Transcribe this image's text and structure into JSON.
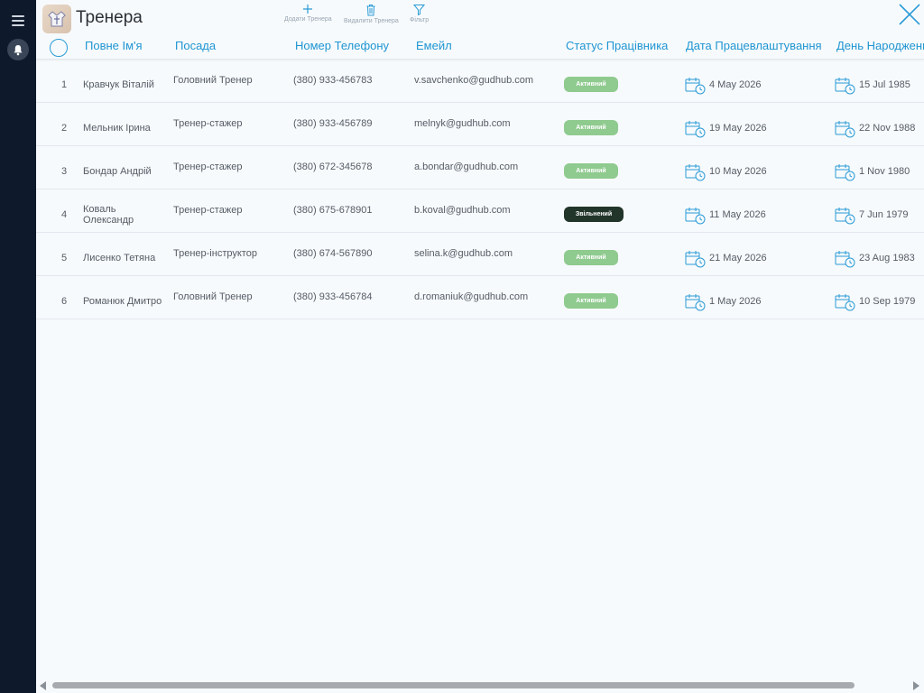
{
  "page": {
    "title": "Тренера"
  },
  "toolbar": {
    "add_label": "Додати Тренера",
    "delete_label": "Видалити Тренера",
    "filter_label": "Фільтр"
  },
  "columns": {
    "name": "Повне Ім'я",
    "position": "Посада",
    "phone": "Номер Телефону",
    "email": "Емейл",
    "status": "Статус Працівника",
    "hire_date": "Дата Працевлаштування",
    "birthday": "День Народження"
  },
  "rows": [
    {
      "num": "1",
      "name": "Кравчук Віталій",
      "position": "Головний Тренер",
      "phone": "(380) 933-456783",
      "email": "v.savchenko@gudhub.com",
      "status": "Активний",
      "hire_date": "4 May 2026",
      "birthday": "15 Jul 1985"
    },
    {
      "num": "2",
      "name": "Мельник Ірина",
      "position": "Тренер-стажер",
      "phone": "(380) 933-456789",
      "email": "melnyk@gudhub.com",
      "status": "Активний",
      "hire_date": "19 May 2026",
      "birthday": "22 Nov 1988"
    },
    {
      "num": "3",
      "name": "Бондар Андрій",
      "position": "Тренер-стажер",
      "phone": "(380) 672-345678",
      "email": "a.bondar@gudhub.com",
      "status": "Активний",
      "hire_date": "10 May 2026",
      "birthday": "1 Nov 1980"
    },
    {
      "num": "4",
      "name": "Коваль Олександр",
      "position": "Тренер-стажер",
      "phone": "(380) 675-678901",
      "email": "b.koval@gudhub.com",
      "status": "Звільнений",
      "hire_date": "11 May 2026",
      "birthday": "7 Jun 1979"
    },
    {
      "num": "5",
      "name": "Лисенко Тетяна",
      "position": "Тренер-інструктор",
      "phone": "(380) 674-567890",
      "email": "selina.k@gudhub.com",
      "status": "Активний",
      "hire_date": "21 May 2026",
      "birthday": "23 Aug 1983"
    },
    {
      "num": "6",
      "name": "Романюк Дмитро",
      "position": "Головний Тренер",
      "phone": "(380) 933-456784",
      "email": "d.romaniuk@gudhub.com",
      "status": "Активний",
      "hire_date": "1 May 2026",
      "birthday": "10 Sep 1979"
    }
  ],
  "colors": {
    "sidebar": "#0e1a2b",
    "accent": "#1f95d2",
    "status_active": "#8fca8f",
    "status_fired": "#22352a"
  },
  "icons": {
    "menu": "hamburger-icon",
    "notifications": "bell-icon",
    "add": "plus-icon",
    "delete": "trash-icon",
    "filter": "funnel-icon",
    "close": "close-icon",
    "date": "calendar-clock-icon"
  }
}
